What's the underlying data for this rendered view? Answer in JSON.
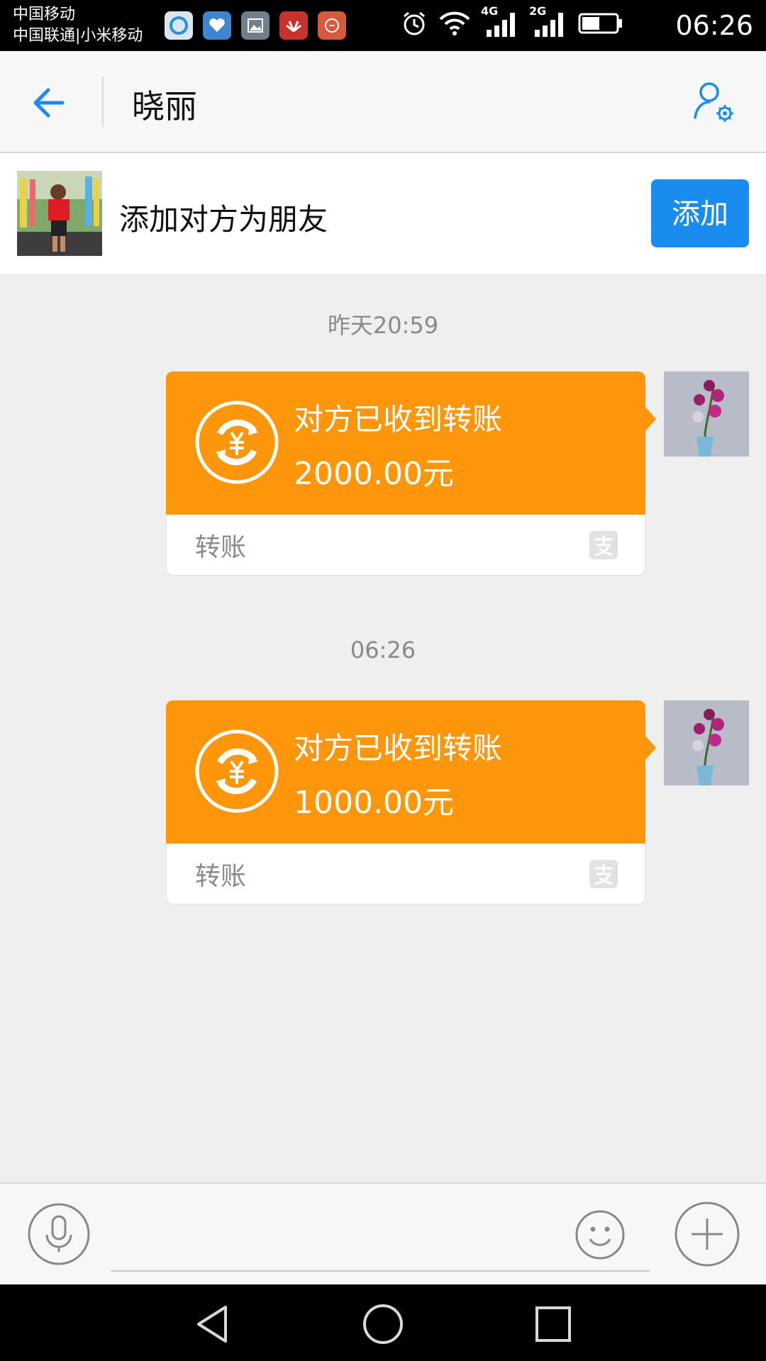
{
  "status_bar": {
    "carrier_1": "中国移动",
    "carrier_2": "中国联通|小米移动",
    "network_1": "4G",
    "network_2": "2G",
    "time": "06:26",
    "notification_icons": [
      "browser-icon",
      "health-icon",
      "gallery-icon",
      "huawei-icon",
      "app-icon"
    ]
  },
  "header": {
    "title": "晓丽"
  },
  "add_friend_banner": {
    "text": "添加对方为朋友",
    "button_label": "添加"
  },
  "messages": [
    {
      "timestamp": "昨天20:59",
      "status": "对方已收到转账",
      "amount": "2000.00元",
      "label": "转账"
    },
    {
      "timestamp": "06:26",
      "status": "对方已收到转账",
      "amount": "1000.00元",
      "label": "转账"
    }
  ],
  "input_bar": {
    "placeholder": ""
  },
  "colors": {
    "accent": "#1a8cf0",
    "transfer_orange": "#fd960b",
    "chat_bg": "#efefef"
  }
}
